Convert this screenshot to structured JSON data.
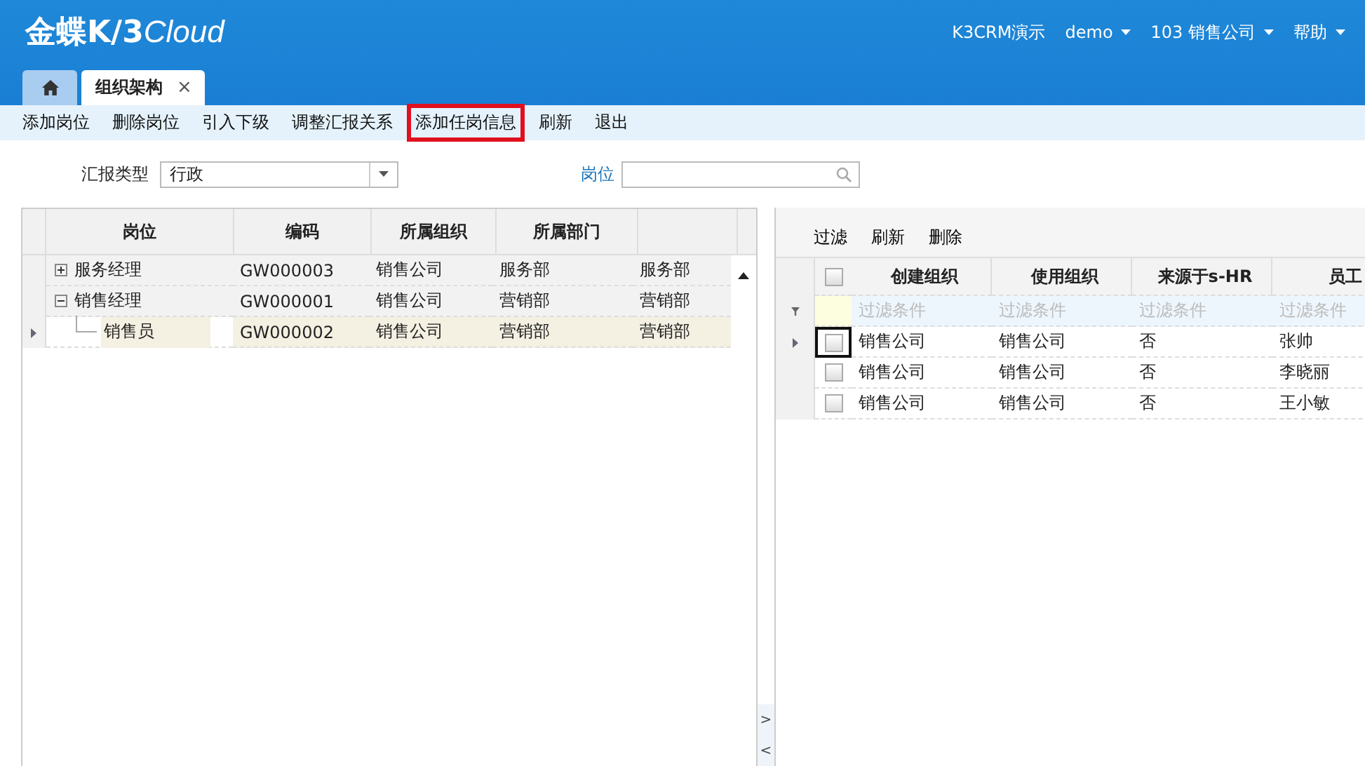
{
  "header": {
    "logo": "金蝶K/3",
    "logo_suffix": "Cloud",
    "menus": [
      {
        "label": "K3CRM演示",
        "dropdown": false
      },
      {
        "label": "demo",
        "dropdown": true
      },
      {
        "label": "103  销售公司",
        "dropdown": true
      },
      {
        "label": "帮助",
        "dropdown": true
      }
    ]
  },
  "tabs": [
    {
      "kind": "home",
      "selected": false
    },
    {
      "kind": "page",
      "label": "组织架构",
      "close": "×",
      "selected": true
    }
  ],
  "toolbar": [
    {
      "label": "添加岗位",
      "highlighted": false
    },
    {
      "label": "删除岗位",
      "highlighted": false
    },
    {
      "label": "引入下级",
      "highlighted": false
    },
    {
      "label": "调整汇报关系",
      "highlighted": false
    },
    {
      "label": "添加任岗信息",
      "highlighted": true
    },
    {
      "label": "刷新",
      "highlighted": false
    },
    {
      "label": "退出",
      "highlighted": false
    }
  ],
  "filter": {
    "report_type_label": "汇报类型",
    "report_type_value": "行政",
    "position_label": "岗位"
  },
  "tree_grid": {
    "columns": [
      "岗位",
      "编码",
      "所属组织",
      "所属部门"
    ],
    "rows": [
      {
        "name": "服务经理",
        "code": "GW000003",
        "org": "销售公司",
        "dept": "服务部",
        "column_5": "服务部",
        "expanded": false,
        "selected": false
      },
      {
        "name": "销售经理",
        "code": "GW000001",
        "org": "销售公司",
        "dept": "营销部",
        "column_5": "营销部",
        "expanded": true,
        "selected": false,
        "children": [
          {
            "name": "销售员",
            "code": "GW000002",
            "org": "销售公司",
            "dept": "营销部",
            "column_5": "营销部",
            "selected": true
          }
        ]
      }
    ]
  },
  "detail": {
    "toolbar": [
      "过滤",
      "刷新",
      "删除"
    ],
    "columns": [
      "创建组织",
      "使用组织",
      "来源于s-HR",
      "员工"
    ],
    "select_all_checked": false,
    "filter_placeholders": [
      "过滤条件",
      "过滤条件",
      "过滤条件",
      "过滤条件"
    ],
    "rows": [
      {
        "create_org": "销售公司",
        "use_org": "销售公司",
        "from_shr": "否",
        "employee": "张帅",
        "checked": false,
        "current": true
      },
      {
        "create_org": "销售公司",
        "use_org": "销售公司",
        "from_shr": "否",
        "employee": "李晓丽",
        "checked": false,
        "current": false
      },
      {
        "create_org": "销售公司",
        "use_org": "销售公司",
        "from_shr": "否",
        "employee": "王小敏",
        "checked": false,
        "current": false
      }
    ]
  },
  "splitter": {
    "expand": ">",
    "collapse": "<"
  }
}
